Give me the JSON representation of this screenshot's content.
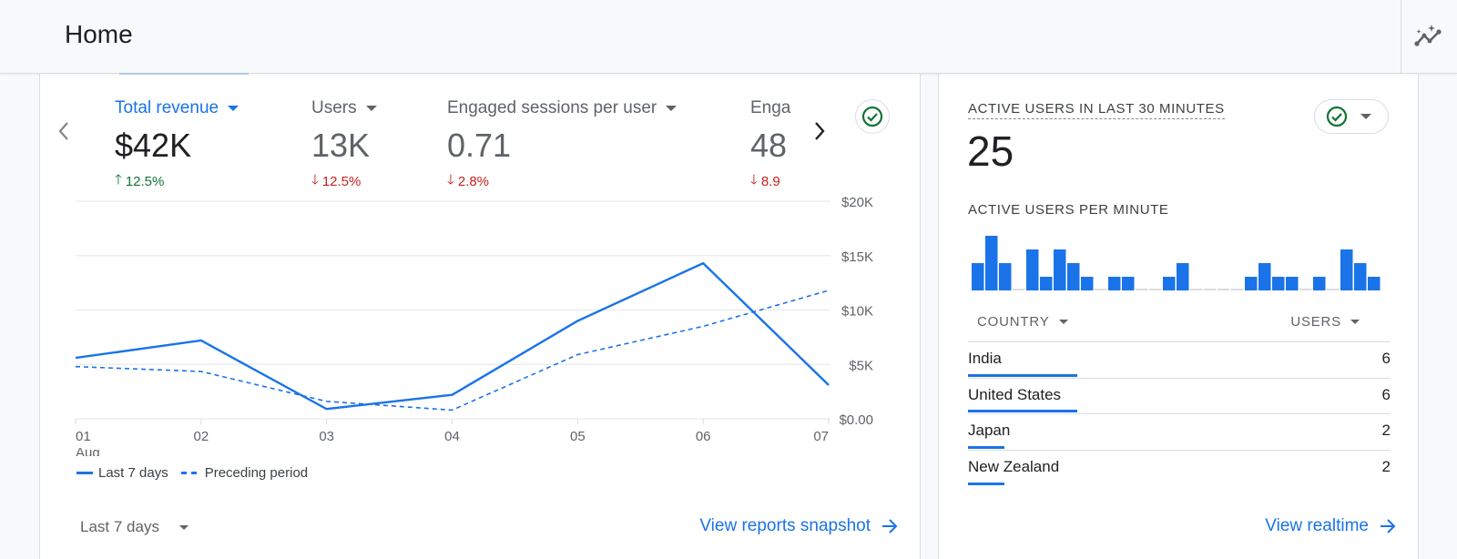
{
  "header": {
    "title": "Home",
    "insights_icon": "insights-sparkle-icon"
  },
  "colors": {
    "accent": "#1a73e8",
    "positive": "#137333",
    "negative": "#c5221f",
    "status_ok": "#137333"
  },
  "kpis": [
    {
      "label": "Total revenue",
      "value": "$42K",
      "delta": "12.5%",
      "direction": "up",
      "active": true
    },
    {
      "label": "Users",
      "value": "13K",
      "delta": "12.5%",
      "direction": "down",
      "active": false
    },
    {
      "label": "Engaged sessions per user",
      "value": "0.71",
      "delta": "2.8%",
      "direction": "down",
      "active": false
    },
    {
      "label": "Enga",
      "value": "48",
      "delta": "8.9",
      "direction": "down",
      "active": false
    }
  ],
  "overview": {
    "range_label": "Last 7 days",
    "link_label": "View reports snapshot",
    "legend": {
      "current": "Last 7 days",
      "previous": "Preceding period"
    }
  },
  "chart_data": {
    "type": "line",
    "title": "Total revenue",
    "x": [
      "01",
      "02",
      "03",
      "04",
      "05",
      "06",
      "07"
    ],
    "x_sublabel": {
      "01": "Aug"
    },
    "series": [
      {
        "name": "Last 7 days",
        "style": "solid",
        "values": [
          5600,
          7200,
          900,
          2200,
          9000,
          14300,
          3100
        ]
      },
      {
        "name": "Preceding period",
        "style": "dashed",
        "values": [
          4800,
          4350,
          1600,
          800,
          5900,
          8500,
          11800
        ]
      }
    ],
    "y_ticks": [
      "$0.00",
      "$5K",
      "$10K",
      "$15K",
      "$20K"
    ],
    "ylim": [
      0,
      20000
    ],
    "y_axis_side": "right",
    "grid": true,
    "legend_position": "bottom-left"
  },
  "realtime": {
    "title": "ACTIVE USERS IN LAST 30 MINUTES",
    "value": "25",
    "per_minute_label": "ACTIVE USERS PER MINUTE",
    "per_minute": [
      2,
      4,
      2,
      0,
      3,
      1,
      3,
      2,
      1,
      0,
      1,
      1,
      0,
      0,
      1,
      2,
      0,
      0,
      0,
      0,
      1,
      2,
      1,
      1,
      0,
      1,
      0,
      3,
      2,
      1
    ],
    "table": {
      "col_country": "COUNTRY",
      "col_users": "USERS",
      "rows": [
        {
          "country": "India",
          "users": "6",
          "share": 1.0
        },
        {
          "country": "United States",
          "users": "6",
          "share": 1.0
        },
        {
          "country": "Japan",
          "users": "2",
          "share": 0.333
        },
        {
          "country": "New Zealand",
          "users": "2",
          "share": 0.333
        }
      ]
    },
    "link_label": "View realtime"
  }
}
